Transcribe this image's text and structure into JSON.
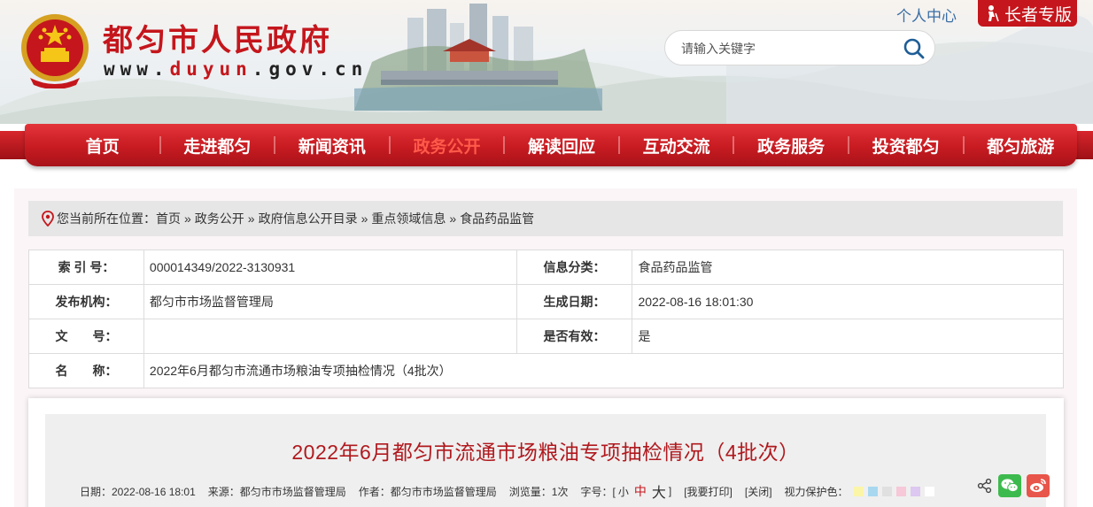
{
  "header": {
    "site_name": "都匀市人民政府",
    "site_url_prefix": "www.",
    "site_url_highlight": "duyun",
    "site_url_suffix": ".gov.cn",
    "user_center": "个人中心",
    "elder_mode": "长者专版",
    "search_placeholder": "请输入关键字"
  },
  "nav": {
    "items": [
      "首页",
      "走进都匀",
      "新闻资讯",
      "政务公开",
      "解读回应",
      "互动交流",
      "政务服务",
      "投资都匀",
      "都匀旅游"
    ],
    "active_index": 3
  },
  "breadcrumb": {
    "prefix": "您当前所在位置：",
    "items": [
      "首页",
      "政务公开",
      "政府信息公开目录",
      "重点领域信息",
      "食品药品监管"
    ],
    "separator": "»"
  },
  "info_table": {
    "index_label": "索 引 号：",
    "index_value": "000014349/2022-3130931",
    "category_label": "信息分类：",
    "category_value": "食品药品监管",
    "publisher_label": "发布机构：",
    "publisher_value": "都匀市市场监督管理局",
    "date_label": "生成日期：",
    "date_value": "2022-08-16 18:01:30",
    "docno_label": "文　　号：",
    "docno_value": "",
    "valid_label": "是否有效：",
    "valid_value": "是",
    "name_label": "名　　称：",
    "name_value": "2022年6月都匀市流通市场粮油专项抽检情况（4批次）"
  },
  "article": {
    "title": "2022年6月都匀市流通市场粮油专项抽检情况（4批次）",
    "meta": {
      "date": "日期：2022-08-16 18:01",
      "source": "来源：都匀市市场监督管理局",
      "author": "作者：都匀市市场监督管理局",
      "views": "浏览量：1次",
      "font_size_prefix": "字号：[",
      "font_small": "小",
      "font_mid": "中",
      "font_big": "大",
      "font_size_suffix": "]",
      "print": "[我要打印]",
      "close": "[关闭]",
      "eye_protect": "视力保护色："
    },
    "eye_colors": [
      "#fbf5a8",
      "#a8d8f0",
      "#e0e0e0",
      "#f6c8d8",
      "#dcc8f0",
      "#f4f4f4"
    ]
  },
  "colors": {
    "brand_red": "#c4161c",
    "link_blue": "#3a6ea5"
  }
}
